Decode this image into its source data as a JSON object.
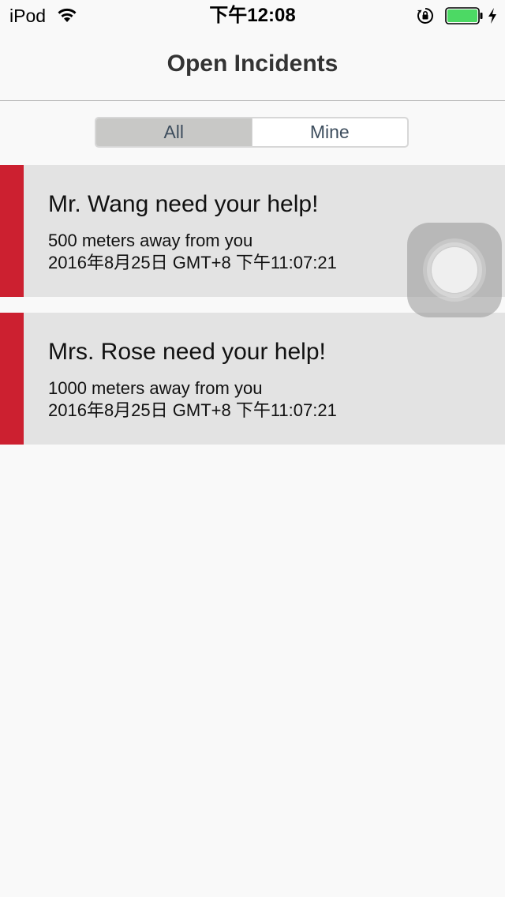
{
  "status_bar": {
    "carrier": "iPod",
    "time": "下午12:08",
    "icons": [
      "wifi-icon",
      "rotation-lock-icon",
      "battery-icon",
      "charging-icon"
    ],
    "battery_color": "#4cd964"
  },
  "nav": {
    "title": "Open Incidents"
  },
  "filter": {
    "options": [
      "All",
      "Mine"
    ],
    "selected": "All"
  },
  "incidents": [
    {
      "title": "Mr. Wang need your help!",
      "distance": "500 meters away from you",
      "time": "2016年8月25日 GMT+8 下午11:07:21"
    },
    {
      "title": "Mrs. Rose need your help!",
      "distance": "1000 meters away from you",
      "time": "2016年8月25日 GMT+8 下午11:07:21"
    }
  ],
  "colors": {
    "accent": "#cc2030",
    "card_background": "#e3e3e3",
    "page_background": "#f9f9f9"
  },
  "overlay": {
    "icon": "assistive-touch-icon"
  }
}
